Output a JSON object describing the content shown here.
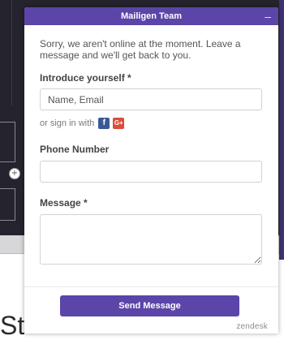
{
  "widget": {
    "title": "Mailigen Team",
    "minimize_symbol": "–",
    "intro": "Sorry, we aren't online at the moment. Leave a message and we'll get back to you.",
    "name_label": "Introduce yourself *",
    "name_placeholder": "Name, Email",
    "signin_text": "or sign in with",
    "facebook_glyph": "f",
    "google_glyph": "G+",
    "phone_label": "Phone Number",
    "phone_value": "",
    "message_label": "Message *",
    "message_value": "",
    "send_label": "Send Message",
    "brand": "zendesk",
    "accent_color": "#5b45a8"
  },
  "background": {
    "partial_text": "St"
  }
}
